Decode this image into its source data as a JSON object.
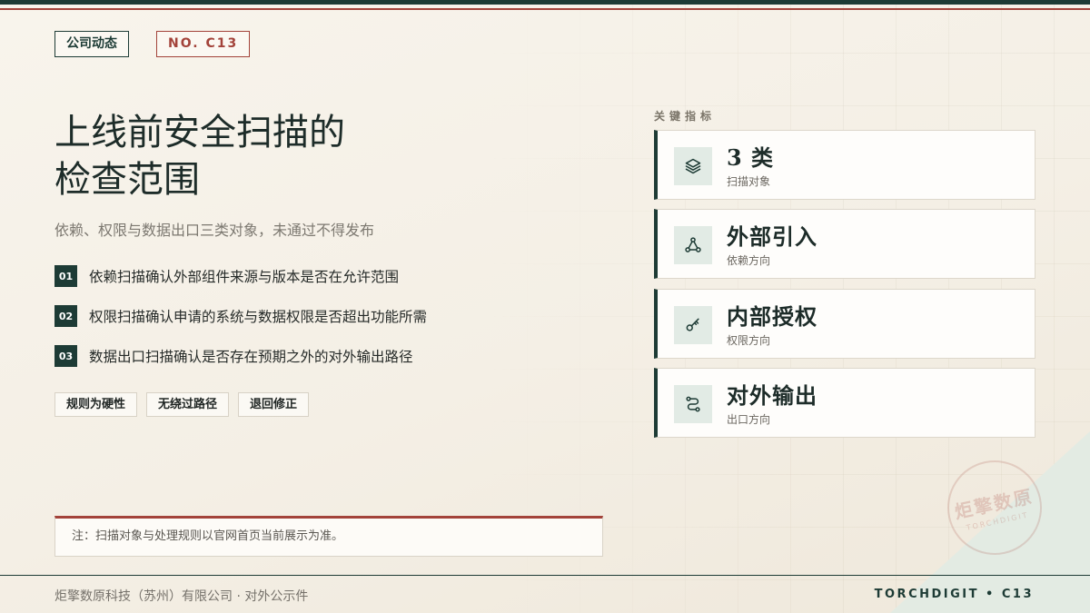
{
  "header": {
    "category_tag": "公司动态",
    "number_tag": "NO. C13"
  },
  "main": {
    "title_line1": "上线前安全扫描的",
    "title_line2": "检查范围",
    "subtitle": "依赖、权限与数据出口三类对象，未通过不得发布",
    "points": [
      {
        "num": "01",
        "text": "依赖扫描确认外部组件来源与版本是否在允许范围"
      },
      {
        "num": "02",
        "text": "权限扫描确认申请的系统与数据权限是否超出功能所需"
      },
      {
        "num": "03",
        "text": "数据出口扫描确认是否存在预期之外的对外输出路径"
      }
    ],
    "pills": [
      "规则为硬性",
      "无绕过路径",
      "退回修正"
    ],
    "note": "注：扫描对象与处理规则以官网首页当前展示为准。"
  },
  "metrics": {
    "section_label": "关键指标",
    "cards": [
      {
        "value": "3 类",
        "label": "扫描对象",
        "icon": "layers-icon"
      },
      {
        "value": "外部引入",
        "label": "依赖方向",
        "icon": "share-nodes-icon"
      },
      {
        "value": "内部授权",
        "label": "权限方向",
        "icon": "key-icon"
      },
      {
        "value": "对外输出",
        "label": "出口方向",
        "icon": "route-icon"
      }
    ]
  },
  "seal": {
    "main": "炬擎数原",
    "sub": "TORCHDIGIT"
  },
  "footer": {
    "company": "炬擎数原科技（苏州）有限公司 · 对外公示件",
    "code": "TORCHDIGIT • C13"
  },
  "colors": {
    "primary": "#1d3b35",
    "accent": "#a3433a",
    "background": "#f6f2ea"
  }
}
